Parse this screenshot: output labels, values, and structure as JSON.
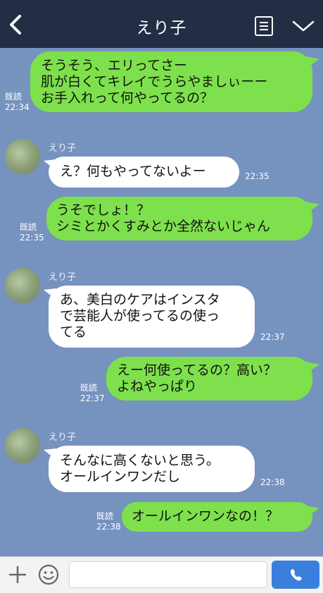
{
  "header": {
    "title": "えり子"
  },
  "messages": [
    {
      "from": "me",
      "text": "そうそう、エリってさー\n肌が白くてキレイでうらやましぃーー\nお手入れって何やってるの？",
      "read": "既読",
      "time": "22:34"
    },
    {
      "from": "them",
      "sender": "えり子",
      "text": "え？何もやってないよー",
      "time": "22:35"
    },
    {
      "from": "me",
      "text": "うそでしょ！？\nシミとかくすみとか全然ないじゃん",
      "read": "既読",
      "time": "22:35"
    },
    {
      "from": "them",
      "sender": "えり子",
      "text": "あ、美白のケアはインスタ\nで芸能人が使ってるの使っ\nてる",
      "time": "22:37"
    },
    {
      "from": "me",
      "text": "えー何使ってるの？高い？\nよねやっぱり",
      "read": "既読",
      "time": "22:37"
    },
    {
      "from": "them",
      "sender": "えり子",
      "text": "そんなに高くないと思う。\nオールインワンだし",
      "time": "22:38"
    },
    {
      "from": "me",
      "text": "オールインワンなの！？",
      "read": "既読",
      "time": "22:38"
    }
  ],
  "footer": {
    "input_placeholder": ""
  },
  "colors": {
    "background": "#7692bf",
    "header": "#232d43",
    "my_bubble": "#7ee04c",
    "their_bubble": "#ffffff",
    "call_button": "#3b7fdc"
  },
  "icons": {
    "back": "chevron-left-icon",
    "menu": "notes-icon",
    "expand": "chevron-down-icon",
    "add": "plus-icon",
    "sticker": "smiley-icon",
    "call": "phone-icon"
  }
}
